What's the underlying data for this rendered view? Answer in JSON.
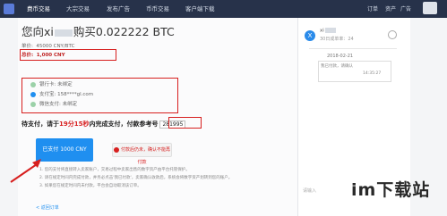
{
  "nav": {
    "items": [
      "费币交易",
      "大宗交易",
      "发布广告",
      "币币交易",
      "客户端下载"
    ],
    "right": [
      "订单",
      "资产",
      "广告"
    ]
  },
  "order": {
    "title_prefix": "您向xi",
    "title_suffix": "购买0.022222 BTC",
    "unit_price": {
      "label": "单价:",
      "value": "45000 CNY/BTC"
    },
    "total": {
      "label": "总价:",
      "value": "1,000 CNY"
    }
  },
  "payment_methods": [
    {
      "icon": "bank-card-icon",
      "name": "银行卡:",
      "value": "未绑定",
      "color": "#9bd1a8"
    },
    {
      "icon": "alipay-icon",
      "name": "支付宝:",
      "value": "158****gl.com",
      "color": "#1f8ff0"
    },
    {
      "icon": "wechat-icon",
      "name": "微信支付:",
      "value": "未绑定",
      "color": "#9bd1a8"
    }
  ],
  "pay_notice": {
    "prefix": "待支付，请于",
    "minutes": "19分15秒",
    "suffix": "内完成支付，付款参考号",
    "ref": "281995"
  },
  "actions": {
    "pay_label": "已支付 1000 CNY",
    "cancel_label": "付款后仍未，确认不能再付款"
  },
  "notes": [
    "1. 您的支付将直接转入卖家账户，交易过程中卖家出售的数字资产由平台托管保护。",
    "2. 请在规定时间内完成付款，并务必点击'我已付款'，卖家确认收款后，系统会将数字资产划转到您的账户。",
    "3. 如果您在规定时间内未付款，平台会自动取消该订单。"
  ],
  "back_label": "< 返回订单",
  "chat": {
    "avatar_letter": "X",
    "name": "xi",
    "sub": "30日成单率：24",
    "date": "2018-02-21",
    "msg1": "我已付款，请确认",
    "msg2": "14:35:27",
    "input_placeholder": "请输入"
  },
  "watermark": {
    "text": "im下载站",
    "sub": ""
  }
}
